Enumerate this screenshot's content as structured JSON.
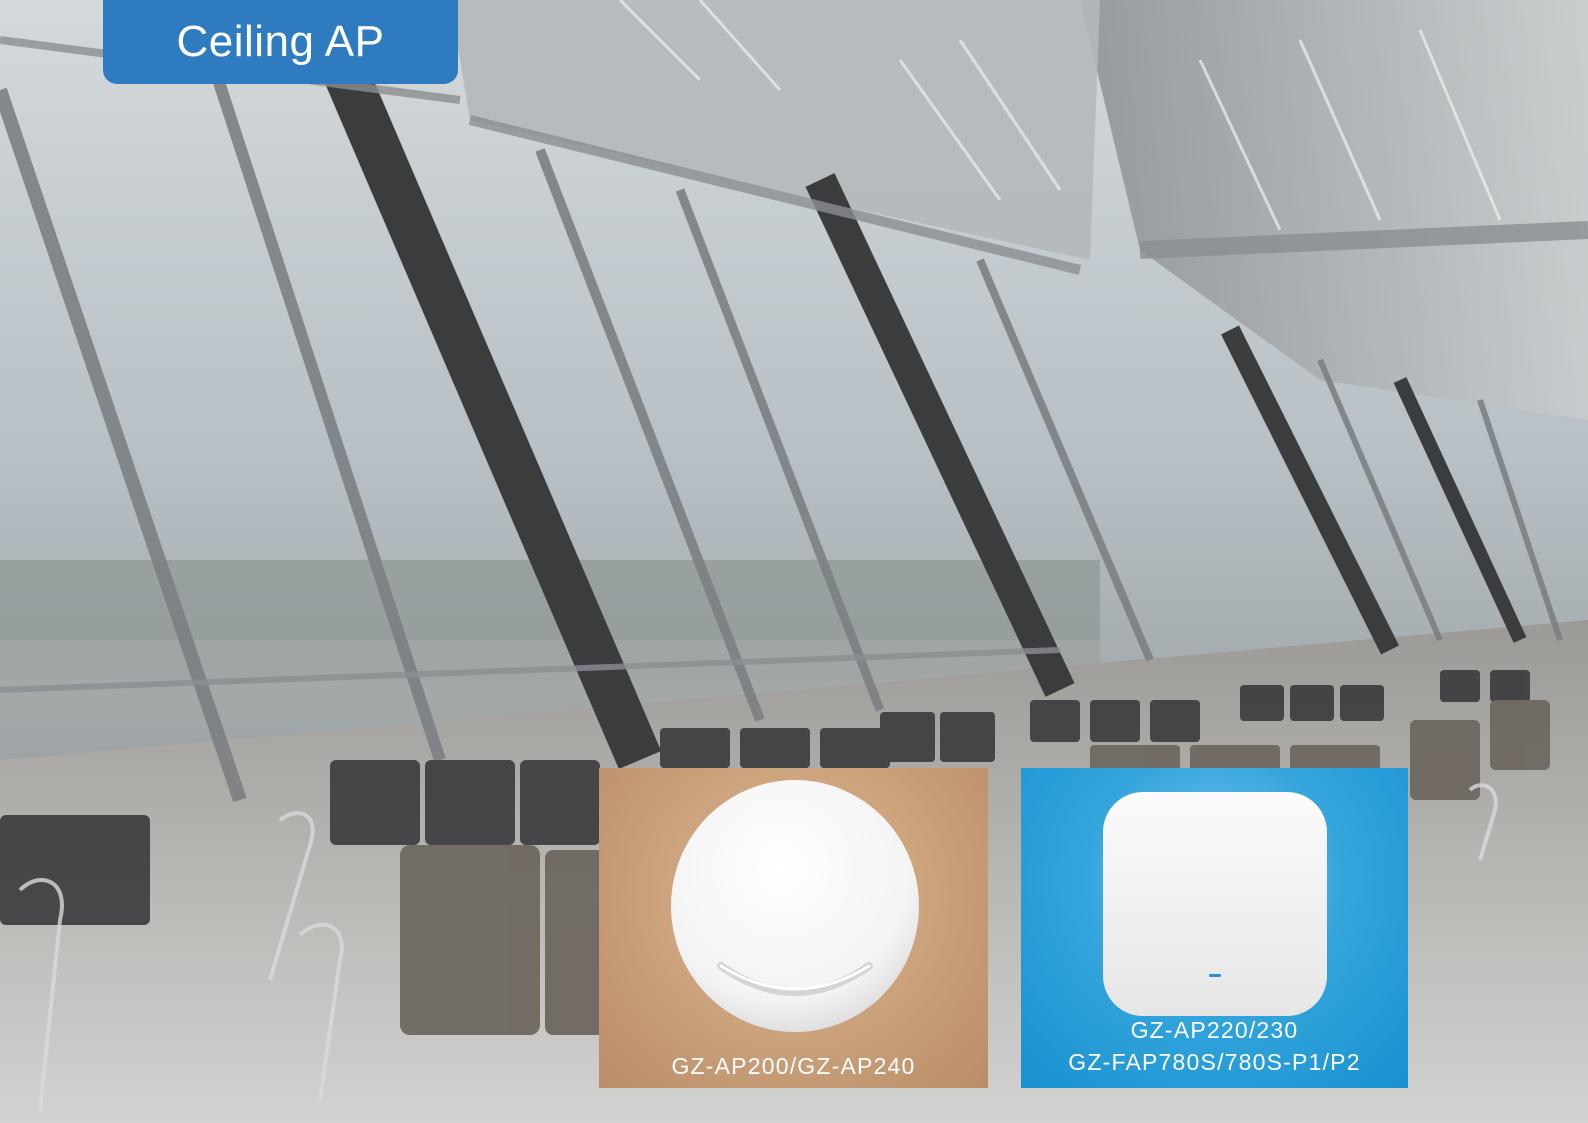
{
  "header": {
    "title": "Ceiling AP"
  },
  "products": [
    {
      "model": "GZ-AP200/GZ-AP240",
      "card_color": "#c9a07a",
      "device_shape": "round-ceiling-ap-icon"
    },
    {
      "model_line1": "GZ-AP220/230",
      "model_line2": "GZ-FAP780S/780S-P1/P2",
      "card_color": "#1f99d6",
      "device_shape": "square-ceiling-ap-icon"
    }
  ],
  "colors": {
    "accent": "#2f7bbf",
    "label_text": "#ffffff"
  }
}
